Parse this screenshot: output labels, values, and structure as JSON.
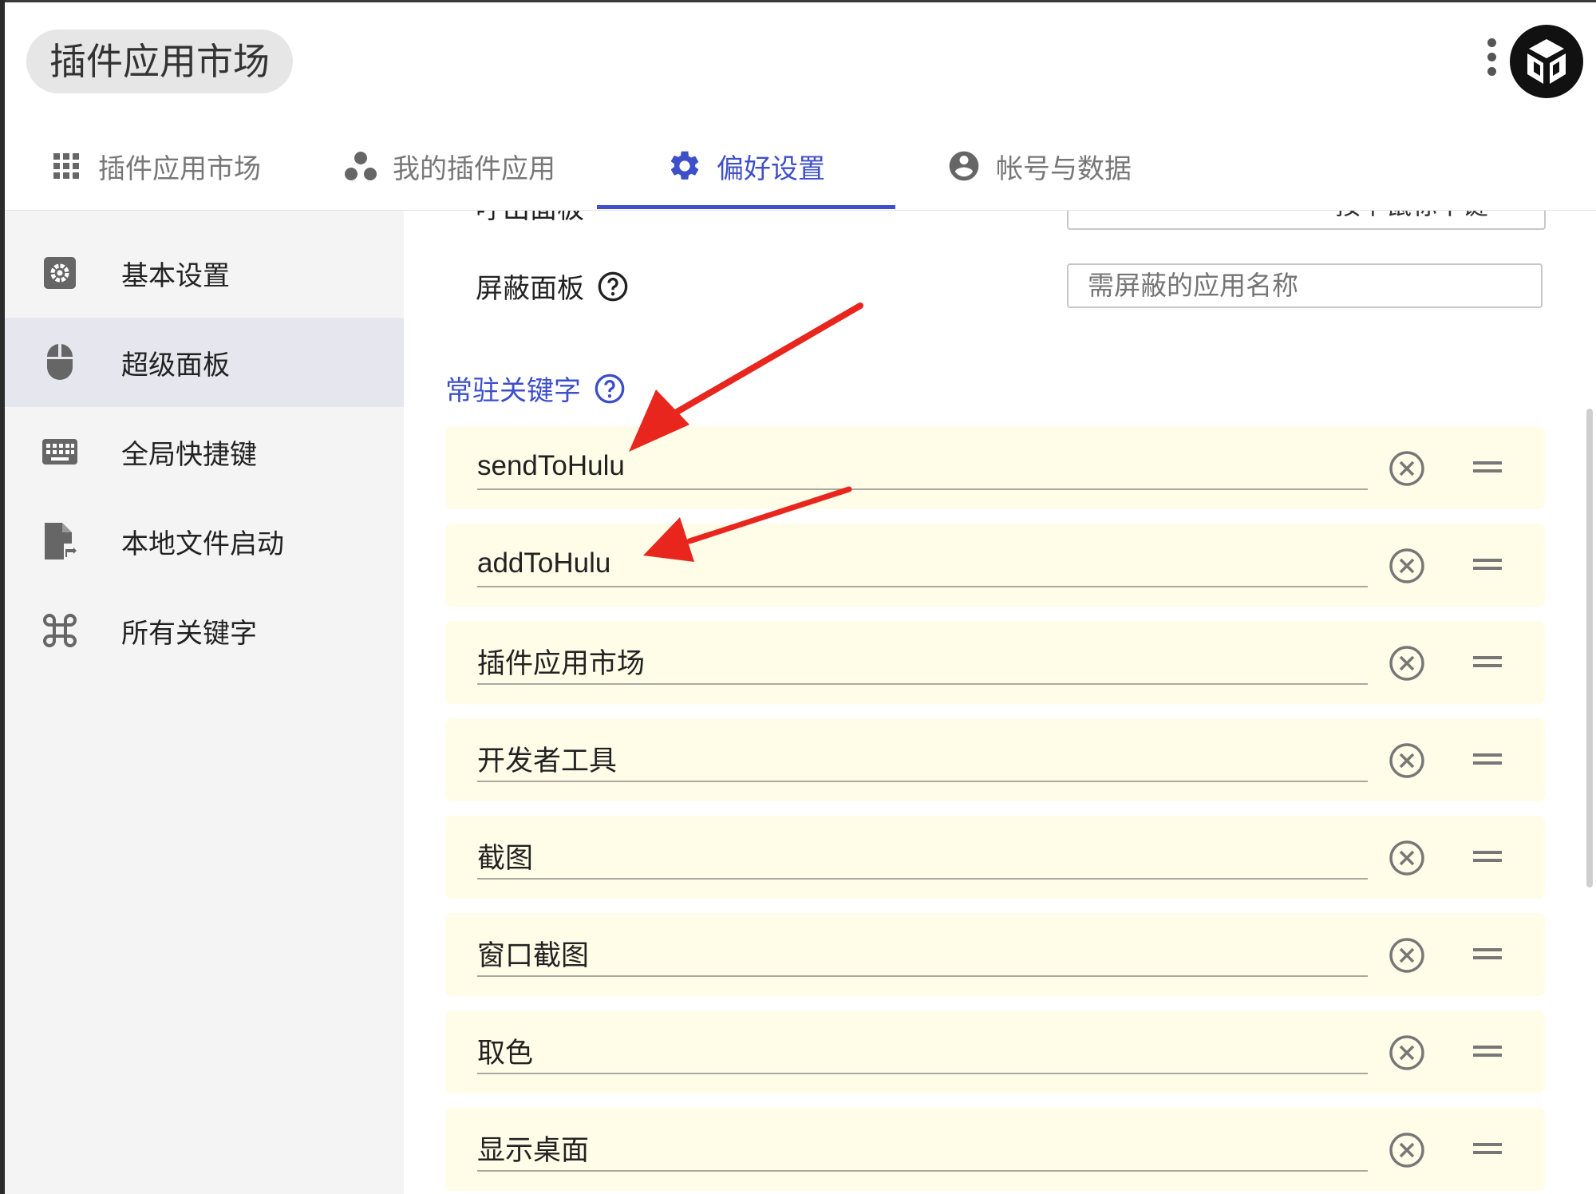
{
  "app": {
    "title": "插件应用市场"
  },
  "tabs": [
    {
      "label": "插件应用市场",
      "icon": "grid-icon"
    },
    {
      "label": "我的插件应用",
      "icon": "cluster-icon"
    },
    {
      "label": "偏好设置",
      "icon": "gear-icon",
      "active": true
    },
    {
      "label": "帐号与数据",
      "icon": "account-icon"
    }
  ],
  "sidebar": {
    "items": [
      {
        "label": "基本设置",
        "icon": "settings-box-icon"
      },
      {
        "label": "超级面板",
        "icon": "mouse-icon",
        "active": true
      },
      {
        "label": "全局快捷键",
        "icon": "keyboard-icon"
      },
      {
        "label": "本地文件启动",
        "icon": "file-launch-icon"
      },
      {
        "label": "所有关键字",
        "icon": "command-key-icon"
      }
    ]
  },
  "main": {
    "cut_off": {
      "label": "呼出面板",
      "value": "按下鼠标中键"
    },
    "shield": {
      "label": "屏蔽面板",
      "placeholder": "需屏蔽的应用名称"
    },
    "keywords_title": "常驻关键字",
    "keywords": [
      "sendToHulu",
      "addToHulu",
      "插件应用市场",
      "开发者工具",
      "截图",
      "窗口截图",
      "取色",
      "显示桌面"
    ]
  },
  "colors": {
    "accent": "#3d4fc9",
    "keyword_bg": "#fffce8",
    "sidebar_bg": "#f4f4f4",
    "sidebar_active": "#e6e7ee",
    "arrow": "#e8261e"
  }
}
